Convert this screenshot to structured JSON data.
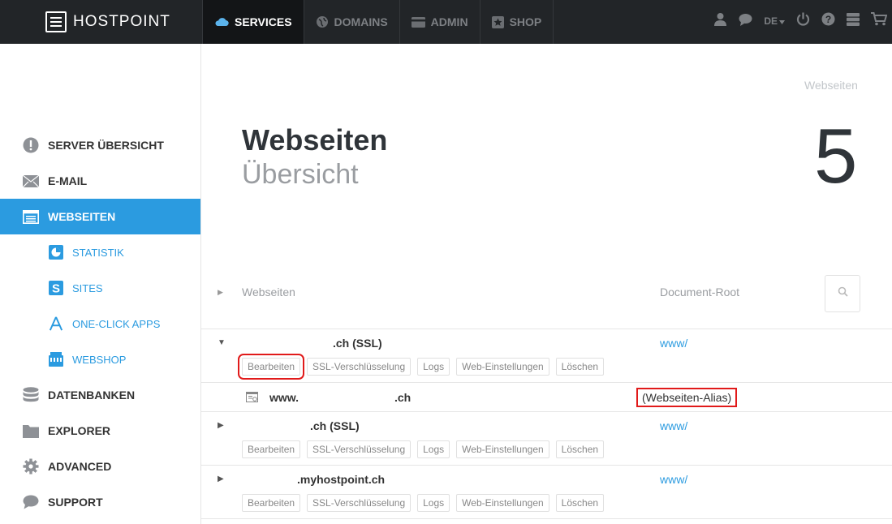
{
  "header": {
    "logo_text": "HOSTPOINT",
    "nav": [
      {
        "label": "SERVICES",
        "icon": "cloud-icon",
        "active": true
      },
      {
        "label": "DOMAINS",
        "icon": "globe-icon"
      },
      {
        "label": "ADMIN",
        "icon": "card-icon"
      },
      {
        "label": "SHOP",
        "icon": "star-icon"
      }
    ],
    "language": "DE",
    "right_icons": [
      "user-icon",
      "chat-icon",
      "language-dropdown",
      "power-icon",
      "help-icon",
      "server-icon",
      "cart-icon"
    ]
  },
  "sidebar": {
    "items": [
      {
        "label": "SERVER ÜBERSICHT",
        "icon": "info-icon"
      },
      {
        "label": "E-MAIL",
        "icon": "envelope-icon"
      },
      {
        "label": "WEBSEITEN",
        "icon": "browser-icon",
        "active": true
      },
      {
        "label": "STATISTIK",
        "icon": "pie-chart-icon",
        "sub": true
      },
      {
        "label": "SITES",
        "icon": "sites-s-icon",
        "sub": true
      },
      {
        "label": "ONE-CLICK APPS",
        "icon": "app-store-icon",
        "sub": true
      },
      {
        "label": "WEBSHOP",
        "icon": "shop-icon",
        "sub": true
      },
      {
        "label": "DATENBANKEN",
        "icon": "database-icon"
      },
      {
        "label": "EXPLORER",
        "icon": "folder-icon"
      },
      {
        "label": "ADVANCED",
        "icon": "gear-icon"
      },
      {
        "label": "SUPPORT",
        "icon": "speech-bubble-icon"
      }
    ]
  },
  "main": {
    "breadcrumb": "Webseiten",
    "title": "Webseiten",
    "subtitle": "Übersicht",
    "count": "5",
    "table": {
      "col_websites": "Webseiten",
      "col_docroot": "Document-Root",
      "rows": [
        {
          "domain": ".ch (SSL)",
          "docroot": "www/",
          "expanded": true
        },
        {
          "alias_domain_prefix": "www.",
          "alias_domain_suffix": ".ch",
          "alias_label": "(Webseiten-Alias)"
        },
        {
          "domain": ".ch (SSL)",
          "docroot": "www/"
        },
        {
          "domain": ".myhostpoint.ch",
          "docroot": "www/"
        }
      ],
      "actions": [
        "Bearbeiten",
        "SSL-Verschlüsselung",
        "Logs",
        "Web-Einstellungen",
        "Löschen"
      ]
    }
  },
  "colors": {
    "accent": "#2b9be0",
    "topbar": "#222528",
    "highlight": "#e11a1a"
  }
}
